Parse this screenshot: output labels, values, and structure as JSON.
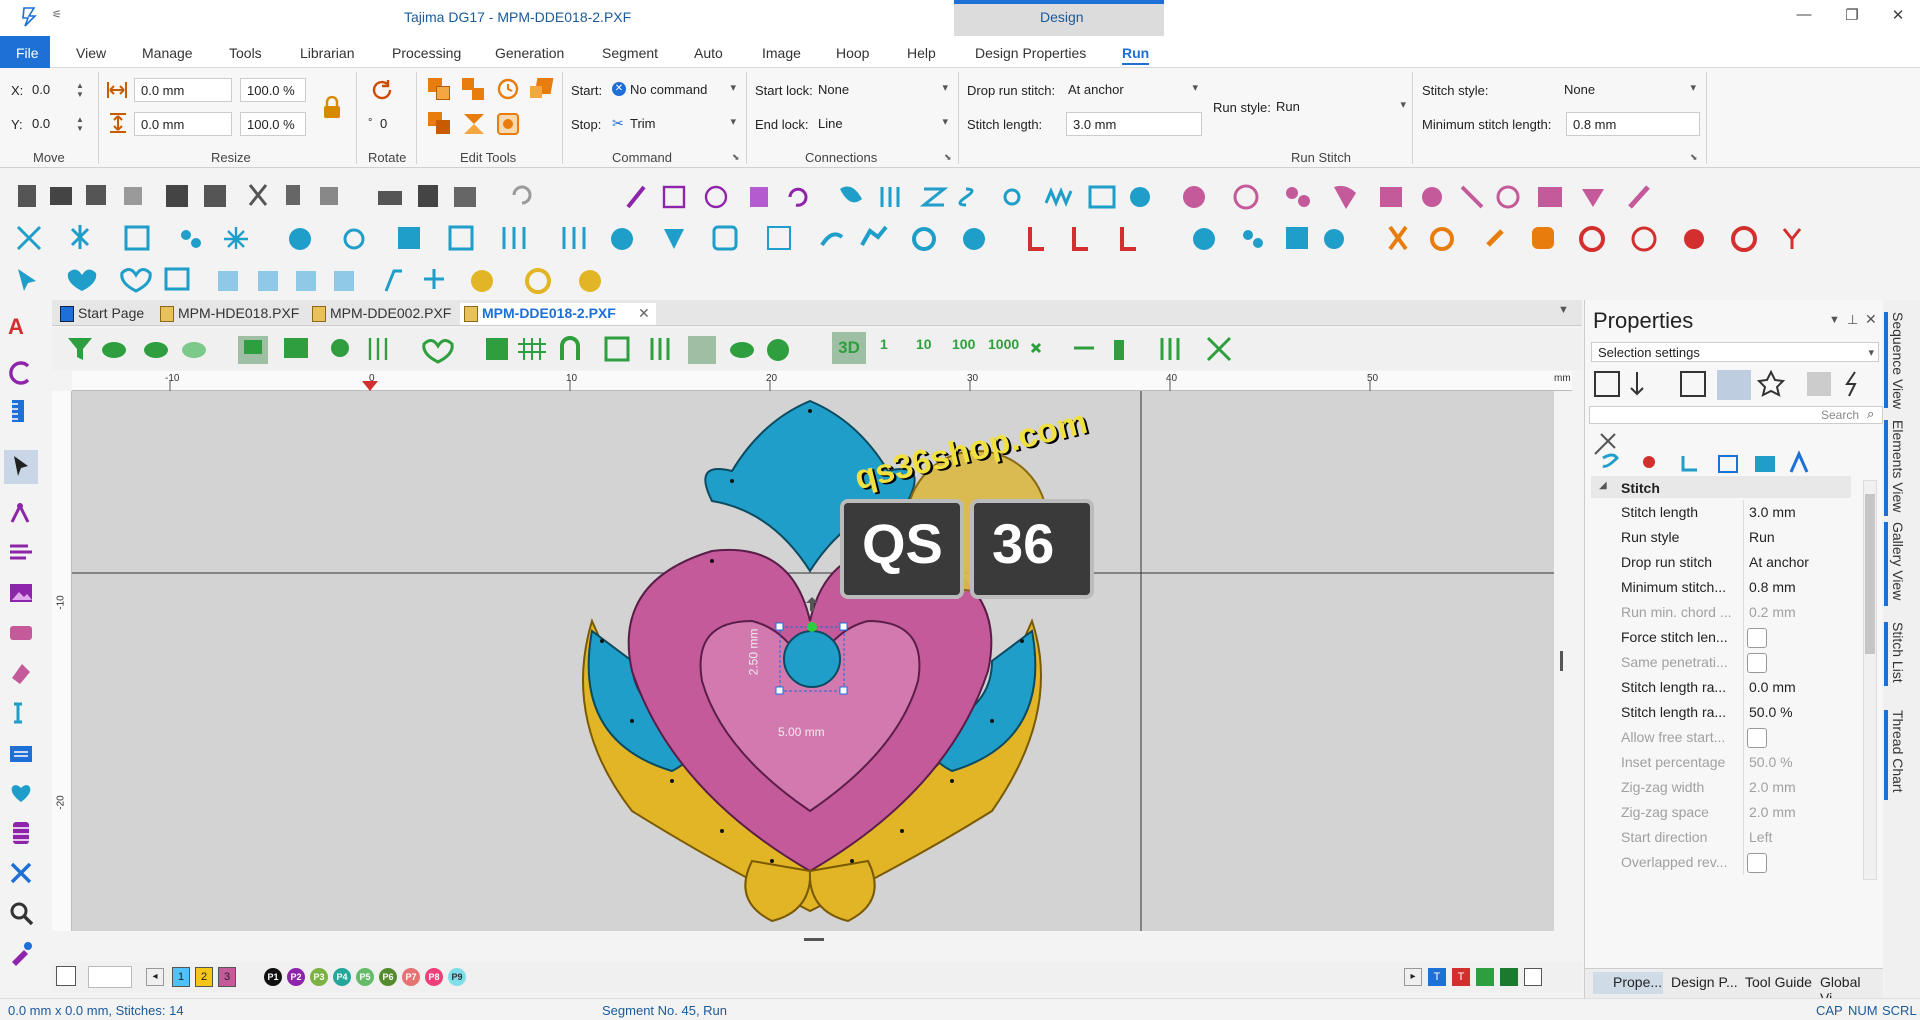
{
  "app": {
    "title": "Tajima DG17 - MPM-DDE018-2.PXF",
    "context_group": "Design",
    "window_controls": [
      "—",
      "❐",
      "✕"
    ]
  },
  "menu": {
    "file": "File",
    "items": [
      "View",
      "Manage",
      "Tools",
      "Librarian",
      "Processing",
      "Generation",
      "Segment",
      "Auto",
      "Image",
      "Hoop",
      "Help"
    ],
    "context_items": [
      "Design Properties",
      "Run"
    ]
  },
  "ribbon": {
    "move": {
      "x_label": "X:",
      "x_value": "0.0",
      "y_label": "Y:",
      "y_value": "0.0",
      "group": "Move"
    },
    "resize": {
      "w_value": "0.0 mm",
      "h_value": "0.0 mm",
      "w_pct": "100.0 %",
      "h_pct": "100.0 %",
      "group": "Resize"
    },
    "rotate": {
      "angle": "0",
      "degree": "°",
      "group": "Rotate"
    },
    "edit_tools": {
      "group": "Edit Tools"
    },
    "command": {
      "start_label": "Start:",
      "start_value": "No command",
      "stop_label": "Stop:",
      "stop_value": "Trim",
      "group": "Command"
    },
    "connections": {
      "start_lock_label": "Start lock:",
      "start_lock_value": "None",
      "end_lock_label": "End lock:",
      "end_lock_value": "Line",
      "group": "Connections"
    },
    "run_stitch": {
      "drop_label": "Drop run stitch:",
      "drop_value": "At anchor",
      "length_label": "Stitch length:",
      "length_value": "3.0 mm",
      "style_label": "Run style:",
      "style_value": "Run",
      "stitch_style_label": "Stitch style:",
      "stitch_style_value": "None",
      "min_len_label": "Minimum stitch length:",
      "min_len_value": "0.8 mm",
      "group": "Run Stitch"
    }
  },
  "doc_tabs": [
    "Start Page",
    "MPM-HDE018.PXF",
    "MPM-DDE002.PXF",
    "MPM-DDE018-2.PXF"
  ],
  "view_toolbar": {
    "counts": [
      "1",
      "10",
      "100",
      "1000"
    ]
  },
  "rulers": {
    "h": [
      "-10",
      "0",
      "10",
      "20",
      "30",
      "40",
      "50"
    ],
    "h_unit": "mm",
    "v": [
      "-10",
      "-20"
    ]
  },
  "canvas": {
    "watermark_site": "qs36shop.com",
    "watermark_qs": "QS",
    "watermark_36": "36",
    "dim_width": "5.00 mm",
    "dim_height": "2.50 mm"
  },
  "colorbar": {
    "needles": [
      "1",
      "2",
      "3"
    ],
    "needle_colors": [
      "#4fc3f7",
      "#f5c518",
      "#c45a9a"
    ],
    "palette": [
      {
        "label": "P1",
        "color": "#111111"
      },
      {
        "label": "P2",
        "color": "#8e24aa"
      },
      {
        "label": "P3",
        "color": "#7cb342"
      },
      {
        "label": "P4",
        "color": "#26a69a"
      },
      {
        "label": "P5",
        "color": "#66bb6a"
      },
      {
        "label": "P6",
        "color": "#558b2f"
      },
      {
        "label": "P7",
        "color": "#e57373"
      },
      {
        "label": "P8",
        "color": "#ec407a"
      },
      {
        "label": "P9",
        "color": "#80deea"
      }
    ]
  },
  "properties": {
    "title": "Properties",
    "selection": "Selection settings",
    "search_placeholder": "Search",
    "section": "Stitch",
    "rows": [
      {
        "k": "Stitch length",
        "v": "3.0 mm",
        "type": "text",
        "enabled": true
      },
      {
        "k": "Run style",
        "v": "Run",
        "type": "text",
        "enabled": true
      },
      {
        "k": "Drop run stitch",
        "v": "At anchor",
        "type": "text",
        "enabled": true
      },
      {
        "k": "Minimum stitch...",
        "v": "0.8 mm",
        "type": "text",
        "enabled": true
      },
      {
        "k": "Run min. chord ...",
        "v": "0.2 mm",
        "type": "text",
        "enabled": false
      },
      {
        "k": "Force stitch len...",
        "v": "",
        "type": "check",
        "enabled": true
      },
      {
        "k": "Same penetrati...",
        "v": "",
        "type": "check",
        "enabled": false
      },
      {
        "k": "Stitch length ra...",
        "v": "0.0 mm",
        "type": "text",
        "enabled": true
      },
      {
        "k": "Stitch length ra...",
        "v": "50.0 %",
        "type": "text",
        "enabled": true
      },
      {
        "k": "Allow free start...",
        "v": "",
        "type": "check",
        "enabled": false
      },
      {
        "k": "Inset percentage",
        "v": "50.0 %",
        "type": "text",
        "enabled": false
      },
      {
        "k": "Zig-zag width",
        "v": "2.0 mm",
        "type": "text",
        "enabled": false
      },
      {
        "k": "Zig-zag space",
        "v": "2.0 mm",
        "type": "text",
        "enabled": false
      },
      {
        "k": "Start direction",
        "v": "Left",
        "type": "text",
        "enabled": false
      },
      {
        "k": "Overlapped rev...",
        "v": "",
        "type": "check",
        "enabled": false
      }
    ],
    "bottom_tabs": [
      "Prope...",
      "Design P...",
      "Tool Guide",
      "Global Vi..."
    ]
  },
  "side_tabs": [
    "Sequence View",
    "Elements View",
    "Gallery View",
    "Stitch List",
    "Thread Chart"
  ],
  "status": {
    "left": "0.0 mm x  0.0 mm, Stitches: 14",
    "center": "Segment No. 45, Run",
    "right": [
      "CAP",
      "NUM",
      "SCRL"
    ]
  },
  "colors": {
    "accent": "#1e6fd6",
    "pink": "#c45a9a",
    "teal": "#1e9ec9",
    "gold": "#e2b526"
  }
}
